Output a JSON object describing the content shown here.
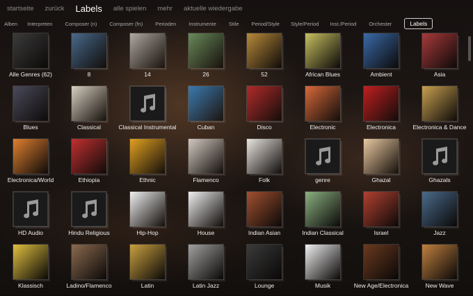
{
  "topnav": {
    "items": [
      "startseite",
      "zurück",
      "Labels",
      "alle spielen",
      "mehr",
      "aktuelle wiedergabe"
    ],
    "active_index": 2
  },
  "tabs": {
    "items": [
      "Alben",
      "Interpreten",
      "Composer (n)",
      "Composer (fn)",
      "Perioden",
      "Instrumente",
      "Stile",
      "Period/Style",
      "Style/Period",
      "Inst./Period",
      "Orchester",
      "Labels"
    ],
    "active_index": 11
  },
  "genres": [
    {
      "label": "Alle Genres (62)",
      "art": "#3b3b3b",
      "icon": "album-art"
    },
    {
      "label": "8",
      "art": "#4a6a8a",
      "icon": "album-art"
    },
    {
      "label": "14",
      "art": "#b0a8a0",
      "icon": "album-art"
    },
    {
      "label": "26",
      "art": "#6a8a5a",
      "icon": "album-art"
    },
    {
      "label": "52",
      "art": "#b88a3a",
      "icon": "album-art"
    },
    {
      "label": "African Blues",
      "art": "#c8c060",
      "icon": "album-art"
    },
    {
      "label": "Ambient",
      "art": "#3a6aa8",
      "icon": "album-art"
    },
    {
      "label": "Asia",
      "art": "#a83a3a",
      "icon": "album-art"
    },
    {
      "label": "Blues",
      "art": "#4a4a5a",
      "icon": "album-art"
    },
    {
      "label": "Classical",
      "art": "#d8d0c0",
      "icon": "album-art"
    },
    {
      "label": "Classical Instrumental",
      "art": "",
      "icon": "music-note-icon"
    },
    {
      "label": "Cuban",
      "art": "#3a7ab0",
      "icon": "album-art"
    },
    {
      "label": "Disco",
      "art": "#b02a2a",
      "icon": "album-art"
    },
    {
      "label": "Electronic",
      "art": "#d86a3a",
      "icon": "album-art"
    },
    {
      "label": "Electronica",
      "art": "#c02020",
      "icon": "album-art"
    },
    {
      "label": "Electronica & Dance",
      "art": "#c8a050",
      "icon": "album-art"
    },
    {
      "label": "Electronica/World",
      "art": "#e08030",
      "icon": "album-art"
    },
    {
      "label": "Ethiopia",
      "art": "#c03030",
      "icon": "album-art"
    },
    {
      "label": "Ethnic",
      "art": "#e0a020",
      "icon": "album-art"
    },
    {
      "label": "Flamenco",
      "art": "#d0c8c0",
      "icon": "album-art"
    },
    {
      "label": "Folk",
      "art": "#e8e4e0",
      "icon": "album-art"
    },
    {
      "label": "genre",
      "art": "",
      "icon": "music-note-icon"
    },
    {
      "label": "Ghazal",
      "art": "#e8c8a0",
      "icon": "album-art"
    },
    {
      "label": "Ghazals",
      "art": "",
      "icon": "music-note-icon"
    },
    {
      "label": "HD Audio",
      "art": "",
      "icon": "music-note-icon"
    },
    {
      "label": "Hindu Religious",
      "art": "",
      "icon": "music-note-icon"
    },
    {
      "label": "Hip-Hop",
      "art": "#f0f0f0",
      "icon": "album-art"
    },
    {
      "label": "House",
      "art": "#f0f0f0",
      "icon": "album-art"
    },
    {
      "label": "Indian Asian",
      "art": "#a05030",
      "icon": "album-art"
    },
    {
      "label": "Indian Classical",
      "art": "#8ab080",
      "icon": "album-art"
    },
    {
      "label": "Israel",
      "art": "#b04030",
      "icon": "album-art"
    },
    {
      "label": "Jazz",
      "art": "#4a6a8a",
      "icon": "album-art"
    },
    {
      "label": "Klassisch",
      "art": "#e0c040",
      "icon": "album-art"
    },
    {
      "label": "Ladino/Flamenco",
      "art": "#8a6a50",
      "icon": "album-art"
    },
    {
      "label": "Latin",
      "art": "#c8a040",
      "icon": "album-art"
    },
    {
      "label": "Latin Jazz",
      "art": "#a0a0a0",
      "icon": "album-art"
    },
    {
      "label": "Lounge",
      "art": "#3a3a3a",
      "icon": "album-art"
    },
    {
      "label": "Musik",
      "art": "#f0f0f0",
      "icon": "album-art"
    },
    {
      "label": "New Age/Electronica",
      "art": "#6a3a20",
      "icon": "album-art"
    },
    {
      "label": "New Wave",
      "art": "#c08040",
      "icon": "album-art"
    }
  ]
}
